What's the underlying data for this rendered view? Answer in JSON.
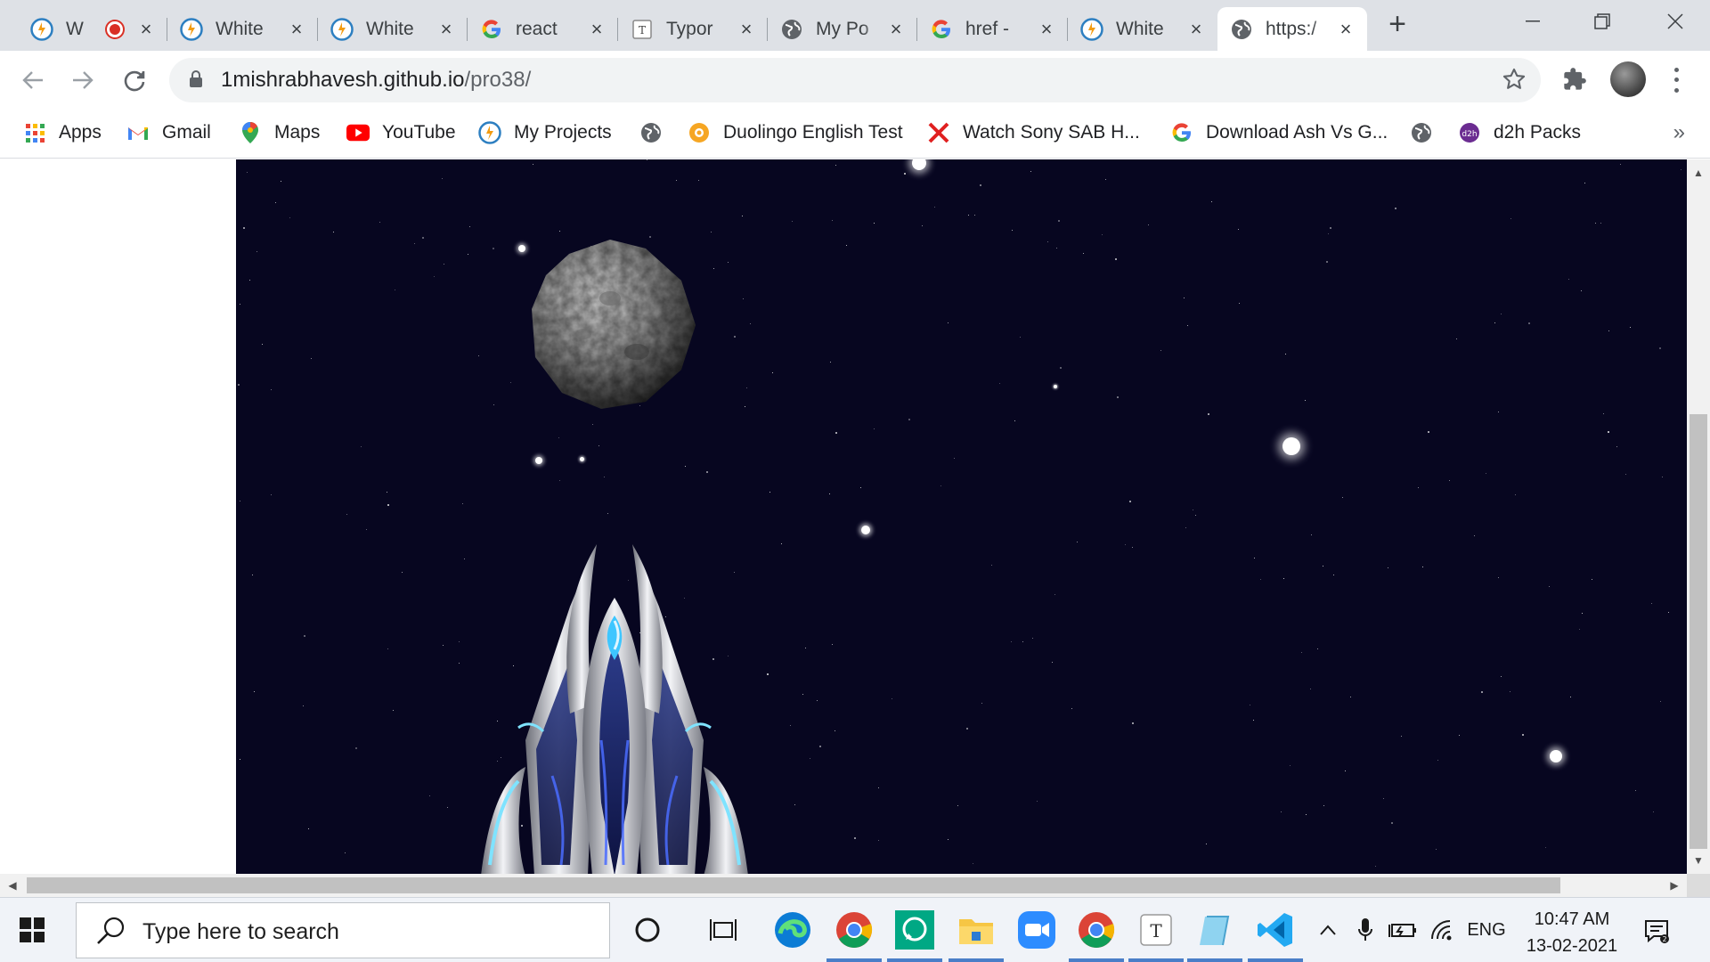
{
  "browser": {
    "tabs": [
      {
        "title": "W",
        "icon": "whitehat-icon",
        "recording": true
      },
      {
        "title": "White",
        "icon": "whitehat-icon"
      },
      {
        "title": "White",
        "icon": "whitehat-icon"
      },
      {
        "title": "react",
        "icon": "google-icon"
      },
      {
        "title": "Typor",
        "icon": "typora-icon"
      },
      {
        "title": "My Po",
        "icon": "globe-icon"
      },
      {
        "title": "href -",
        "icon": "google-icon"
      },
      {
        "title": "White",
        "icon": "whitehat-icon"
      },
      {
        "title": "https:/",
        "icon": "globe-icon",
        "active": true
      }
    ],
    "url_host": "1mishrabhavesh.github.io",
    "url_path": "/pro38/",
    "bookmarks": [
      {
        "label": "Apps",
        "icon": "apps-grid-icon"
      },
      {
        "label": "Gmail",
        "icon": "gmail-icon"
      },
      {
        "label": "Maps",
        "icon": "maps-pin-icon"
      },
      {
        "label": "YouTube",
        "icon": "youtube-icon"
      },
      {
        "label": "My Projects",
        "icon": "whitehat-icon"
      },
      {
        "label": "",
        "icon": "globe-icon"
      },
      {
        "label": "Duolingo English Test",
        "icon": "duolingo-icon"
      },
      {
        "label": "Watch Sony SAB H...",
        "icon": "sony-x-icon"
      },
      {
        "label": "Download Ash Vs G...",
        "icon": "google-icon"
      },
      {
        "label": "",
        "icon": "globe-icon"
      },
      {
        "label": "d2h Packs",
        "icon": "d2h-icon"
      }
    ],
    "bookmarks_more": "»"
  },
  "game": {
    "background_color": "#070620",
    "sprites": [
      "asteroid",
      "spaceship"
    ]
  },
  "taskbar": {
    "search_placeholder": "Type here to search",
    "pinned_apps": [
      "cortana-icon",
      "task-view-icon",
      "edge-icon",
      "chrome-icon",
      "whatsapp-icon",
      "file-explorer-icon",
      "zoom-icon",
      "chrome-icon",
      "typora-icon",
      "notepad-icon",
      "vscode-icon"
    ],
    "tray": {
      "language": "ENG",
      "time": "10:47 AM",
      "date": "13-02-2021"
    }
  },
  "colors": {
    "tabstrip": "#dee1e6",
    "accent": "#1a73e8",
    "taskbar": "#f0f3f8"
  }
}
